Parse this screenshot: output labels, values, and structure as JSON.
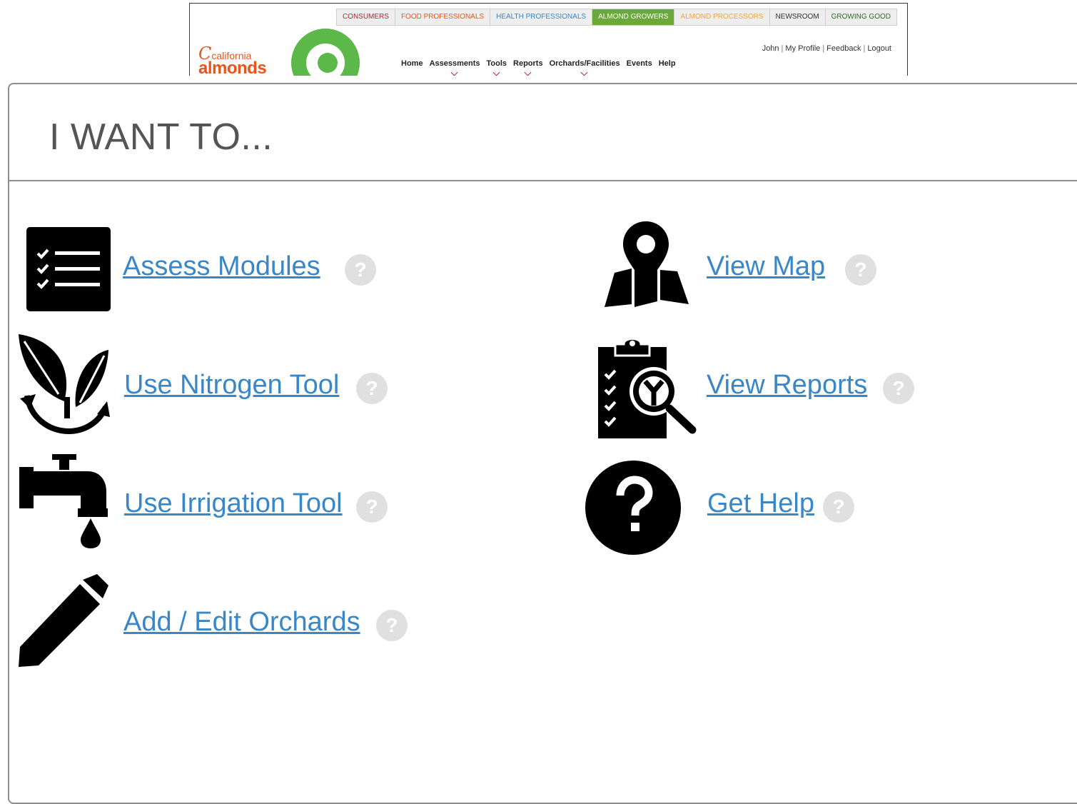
{
  "header": {
    "audience_tabs": [
      {
        "label": "CONSUMERS",
        "color": "#b0263b",
        "bg": "#eeeeee"
      },
      {
        "label": "FOOD PROFESSIONALS",
        "color": "#e8561c",
        "bg": "#eeeeee"
      },
      {
        "label": "HEALTH PROFESSIONALS",
        "color": "#3a87c8",
        "bg": "#eeeeee"
      },
      {
        "label": "ALMOND GROWERS",
        "color": "#ffffff",
        "bg": "#6aa83a"
      },
      {
        "label": "ALMOND PROCESSORS",
        "color": "#f0a830",
        "bg": "#eeeeee"
      },
      {
        "label": "NEWSROOM",
        "color": "#333333",
        "bg": "#eeeeee"
      },
      {
        "label": "GROWING GOOD",
        "color": "#2e6d2a",
        "bg": "#eeeeee"
      }
    ],
    "logo": {
      "script": "C",
      "small": "california",
      "big": "almonds",
      "mark": "·"
    },
    "user_links": {
      "name": "John",
      "profile": "My Profile",
      "feedback": "Feedback",
      "logout": "Logout",
      "separator": "|"
    },
    "nav": [
      "Home",
      "Assessments",
      "Tools",
      "Reports",
      "Orchards/Facilities",
      "Events",
      "Help"
    ]
  },
  "panel": {
    "title": "I WANT TO...",
    "help_symbol": "?",
    "actions": [
      {
        "label": "Assess Modules",
        "icon": "checklist-icon"
      },
      {
        "label": "Use Nitrogen Tool",
        "icon": "leaf-cycle-icon"
      },
      {
        "label": "Use Irrigation Tool",
        "icon": "faucet-icon"
      },
      {
        "label": "Add / Edit Orchards",
        "icon": "pencil-icon"
      },
      {
        "label": "View Map",
        "icon": "map-pin-icon"
      },
      {
        "label": "View Reports",
        "icon": "report-magnifier-icon"
      },
      {
        "label": "Get Help",
        "icon": "question-circle-icon"
      }
    ]
  },
  "colors": {
    "link": "#3a87c8",
    "title": "#555555",
    "border": "#8e8e8e",
    "accent_green": "#5db84a",
    "logo_orange": "#e8561c"
  }
}
